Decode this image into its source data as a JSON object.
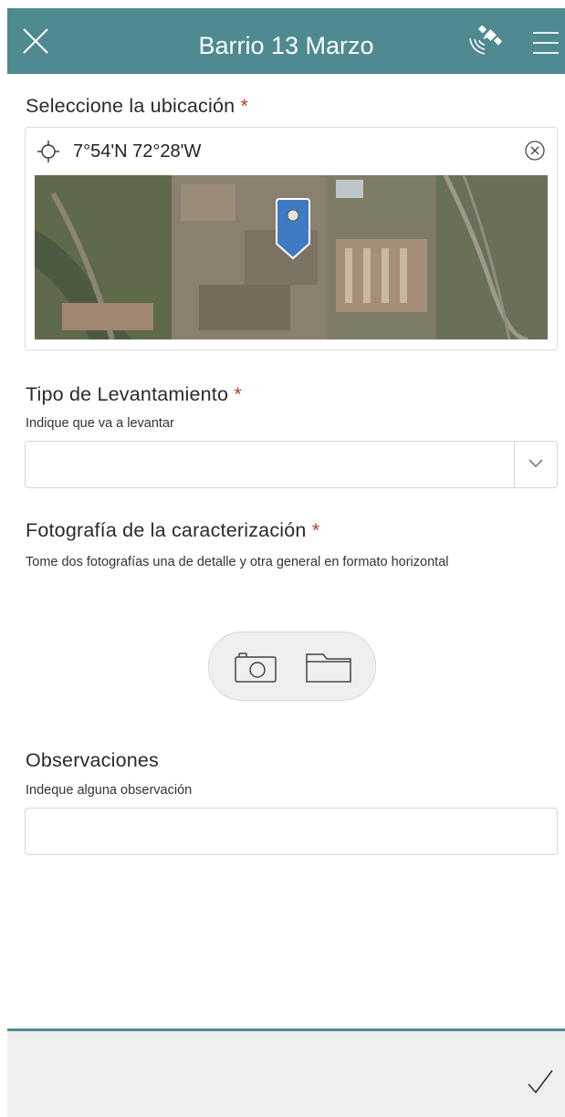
{
  "header": {
    "title": "Barrio 13 Marzo",
    "close_icon": "close-icon",
    "gps_icon": "satellite-gps-icon",
    "menu_icon": "menu-icon",
    "color": "#4e8a90"
  },
  "location": {
    "label": "Seleccione la ubicación",
    "required": "*",
    "coordinates": "7°54'N 72°28'W",
    "crosshair_icon": "crosshair-icon",
    "clear_icon": "clear-icon"
  },
  "tipo": {
    "label": "Tipo de Levantamiento",
    "required": "*",
    "hint": "Indique que va a levantar",
    "value": ""
  },
  "foto": {
    "label": "Fotografía de la caracterización",
    "required": "*",
    "hint": "Tome dos fotografías una de detalle y otra general en formato horizontal",
    "camera_icon": "camera-icon",
    "folder_icon": "folder-icon"
  },
  "observaciones": {
    "label": "Observaciones",
    "hint": "Indeque alguna observación",
    "value": ""
  },
  "footer": {
    "submit_icon": "checkmark-icon"
  },
  "colors": {
    "accent": "#4e8a90",
    "required": "#c0392b",
    "marker": "#3f7ac4"
  }
}
